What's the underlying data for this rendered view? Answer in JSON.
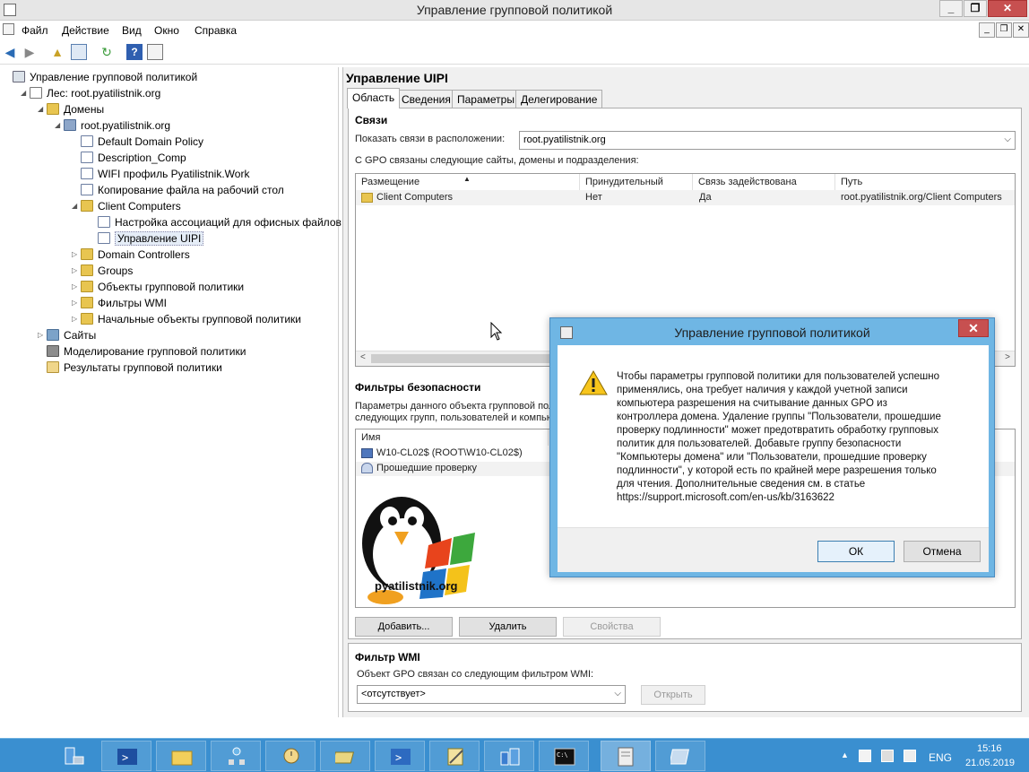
{
  "window": {
    "title": "Управление групповой политикой"
  },
  "menu": [
    "Файл",
    "Действие",
    "Вид",
    "Окно",
    "Справка"
  ],
  "tree": [
    {
      "label": "Управление групповой политикой",
      "icon": "gpmc-root-icon",
      "level": 0,
      "expander": ""
    },
    {
      "label": "Лес: root.pyatilistnik.org",
      "icon": "forest-icon",
      "level": 1,
      "expander": "expanded"
    },
    {
      "label": "Домены",
      "icon": "domains-folder-icon",
      "level": 2,
      "expander": "expanded"
    },
    {
      "label": "root.pyatilistnik.org",
      "icon": "domain-icon",
      "level": 3,
      "expander": "expanded"
    },
    {
      "label": "Default Domain Policy",
      "icon": "gpo-link-icon",
      "level": 4,
      "expander": ""
    },
    {
      "label": "Description_Comp",
      "icon": "gpo-link-icon",
      "level": 4,
      "expander": ""
    },
    {
      "label": "WIFI профиль Pyatilistnik.Work",
      "icon": "gpo-link-icon",
      "level": 4,
      "expander": ""
    },
    {
      "label": "Копирование файла на рабочий стол",
      "icon": "gpo-link-icon",
      "level": 4,
      "expander": ""
    },
    {
      "label": "Client Computers",
      "icon": "ou-folder-icon",
      "level": 4,
      "expander": "expanded"
    },
    {
      "label": "Настройка ассоциаций для офисных файлов",
      "icon": "gpo-link-icon",
      "level": 5,
      "expander": ""
    },
    {
      "label": "Управление UIPI",
      "icon": "gpo-link-icon",
      "level": 5,
      "expander": "",
      "selected": true
    },
    {
      "label": "Domain Controllers",
      "icon": "ou-folder-icon",
      "level": 4,
      "expander": "collapsed"
    },
    {
      "label": "Groups",
      "icon": "ou-folder-icon",
      "level": 4,
      "expander": "collapsed"
    },
    {
      "label": "Объекты групповой политики",
      "icon": "folder-icon",
      "level": 4,
      "expander": "collapsed"
    },
    {
      "label": "Фильтры WMI",
      "icon": "folder-icon",
      "level": 4,
      "expander": "collapsed"
    },
    {
      "label": "Начальные объекты групповой политики",
      "icon": "folder-icon",
      "level": 4,
      "expander": "collapsed"
    },
    {
      "label": "Сайты",
      "icon": "sites-icon",
      "level": 2,
      "expander": "collapsed"
    },
    {
      "label": "Моделирование групповой политики",
      "icon": "modeling-icon",
      "level": 2,
      "expander": ""
    },
    {
      "label": "Результаты групповой политики",
      "icon": "results-icon",
      "level": 2,
      "expander": ""
    }
  ],
  "panel": {
    "title": "Управление UIPI",
    "tabs": [
      "Область",
      "Сведения",
      "Параметры",
      "Делегирование"
    ],
    "links": {
      "heading": "Связи",
      "show_label": "Показать связи в расположении:",
      "location": "root.pyatilistnik.org",
      "linked_text": "С GPO связаны следующие сайты, домены и подразделения:",
      "columns": [
        "Размещение",
        "Принудительный",
        "Связь задействована",
        "Путь"
      ],
      "rows": [
        {
          "place": "Client Computers",
          "enforced": "Нет",
          "enabled": "Да",
          "path": "root.pyatilistnik.org/Client Computers"
        }
      ]
    },
    "security": {
      "heading": "Фильтры безопасности",
      "text1": "Параметры данного объекта групповой пол",
      "text2": "следующих групп, пользователей и компью",
      "column": "Имя",
      "rows": [
        "W10-CL02$ (ROOT\\W10-CL02$)",
        "Прошедшие проверку"
      ],
      "add": "Добавить...",
      "remove": "Удалить",
      "properties": "Свойства"
    },
    "wmi": {
      "heading": "Фильтр WMI",
      "text": "Объект GPO связан со следующим фильтром WMI:",
      "value": "<отсутствует>",
      "open": "Открыть"
    }
  },
  "logo": {
    "text": "pyatilistnik.org"
  },
  "dialog": {
    "title": "Управление групповой политикой",
    "lines": [
      "Чтобы параметры групповой политики для пользователей успешно",
      "применялись, она требует наличия у каждой учетной записи",
      "компьютера разрешения на считывание данных GPO из",
      "контроллера домена. Удаление группы \"Пользователи, прошедшие",
      "проверку подлинности\" может предотвратить обработку групповых",
      "политик для пользователей. Добавьте группу безопасности",
      "\"Компьютеры домена\" или \"Пользователи, прошедшие проверку",
      "подлинности\", у которой есть по крайней мере разрешения только",
      "для чтения. Дополнительные сведения см. в статье",
      "https://support.microsoft.com/en-us/kb/3163622"
    ],
    "ok": "ОК",
    "cancel": "Отмена"
  },
  "taskbar": {
    "language": "ENG",
    "time": "15:16",
    "date": "21.05.2019"
  }
}
